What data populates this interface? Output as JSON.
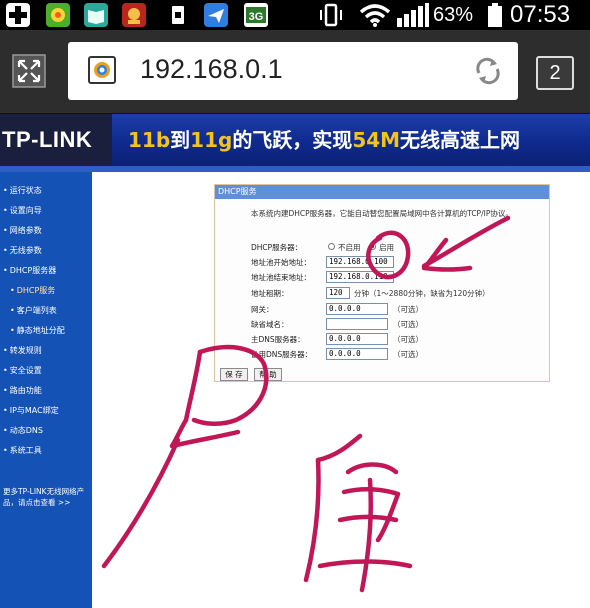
{
  "statusbar": {
    "battery_percent": "63%",
    "time": "07:53",
    "icons": [
      "plus-icon",
      "leaf-app-icon",
      "book-app-icon",
      "game-app-icon",
      "sim-card-icon",
      "plane-app-icon",
      "3g-icon",
      "vibrate-icon",
      "wifi-icon",
      "signal-icon",
      "battery-icon"
    ]
  },
  "browser": {
    "url": "192.168.0.1",
    "tab_count": "2",
    "icons": [
      "expand-icon",
      "site-icon",
      "refresh-icon"
    ]
  },
  "banner": {
    "logo": "TP-LINK",
    "slogan_a": "11b",
    "slogan_b": "到",
    "slogan_c": "11g",
    "slogan_d": "的飞跃，实现",
    "slogan_e": "54M",
    "slogan_f": "无线高速上网",
    "accent_color": "#f2c21e"
  },
  "sidebar": {
    "items": [
      {
        "label": "运行状态"
      },
      {
        "label": "设置向导"
      },
      {
        "label": "网络参数"
      },
      {
        "label": "无线参数"
      },
      {
        "label": "DHCP服务器"
      },
      {
        "label": "DHCP服务"
      },
      {
        "label": "客户端列表"
      },
      {
        "label": "静态地址分配"
      },
      {
        "label": "转发规则"
      },
      {
        "label": "安全设置"
      },
      {
        "label": "路由功能"
      },
      {
        "label": "IP与MAC绑定"
      },
      {
        "label": "动态DNS"
      },
      {
        "label": "系统工具"
      }
    ],
    "promo": "更多TP-LINK无线网络产品，请点击查看 >>",
    "bg_color": "#1552b5"
  },
  "dhcp": {
    "title": "DHCP服务",
    "description": "本系统内建DHCP服务器，它能自动替您配置局域网中各计算机的TCP/IP协议。",
    "server_label": "DHCP服务器：",
    "disable_label": "不启用",
    "enable_label": "启用",
    "selected": "启用",
    "start_label": "地址池开始地址：",
    "start_value": "192.168.0.100",
    "end_label": "地址池结束地址：",
    "end_value": "192.168.0.110",
    "lease_label": "地址租期：",
    "lease_value": "120",
    "lease_hint": "分钟（1～2880分钟，缺省为120分钟）",
    "gateway_label": "网关：",
    "gateway_value": "0.0.0.0",
    "domain_label": "缺省域名：",
    "domain_value": "",
    "dns1_label": "主DNS服务器：",
    "dns1_value": "0.0.0.0",
    "dns2_label": "备用DNS服务器：",
    "dns2_value": "0.0.0.0",
    "optional": "（可选）",
    "save": "保 存",
    "help": "帮 助"
  },
  "annotation": {
    "color": "#c21757"
  }
}
